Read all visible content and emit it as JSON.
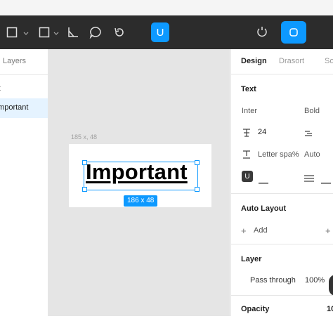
{
  "toolbar": {
    "text_tool_label": "U",
    "colors": {
      "bar": "#2c2c2c",
      "accent": "#0d99ff"
    },
    "icons": [
      "frame-icon",
      "rectangle-icon",
      "pen-icon",
      "comment-icon",
      "undo-icon",
      "component-icon",
      "share-icon"
    ]
  },
  "layers_panel": {
    "header": "Layers",
    "group_label": "t",
    "selected_layer": "Important"
  },
  "canvas": {
    "frame_label": "185 x, 48",
    "text_content": "Important",
    "selection_size": "186 x 48"
  },
  "design_panel": {
    "tabs": [
      "Design",
      "Drasort",
      "So"
    ],
    "text_section": {
      "title": "Text",
      "font_family": "Inter",
      "font_weight": "Bold",
      "font_size": "24",
      "letter_spacing_label": "Letter spa%",
      "line_height": "Auto",
      "underline_label": "U"
    },
    "auto_layout": {
      "title": "Auto Layout",
      "add_label": "Add",
      "plus_right": "+"
    },
    "layer": {
      "title": "Layer",
      "blend_mode": "Pass through",
      "opacity": "100%"
    },
    "opacity_row": {
      "title": "Opacity",
      "value": "10"
    }
  }
}
